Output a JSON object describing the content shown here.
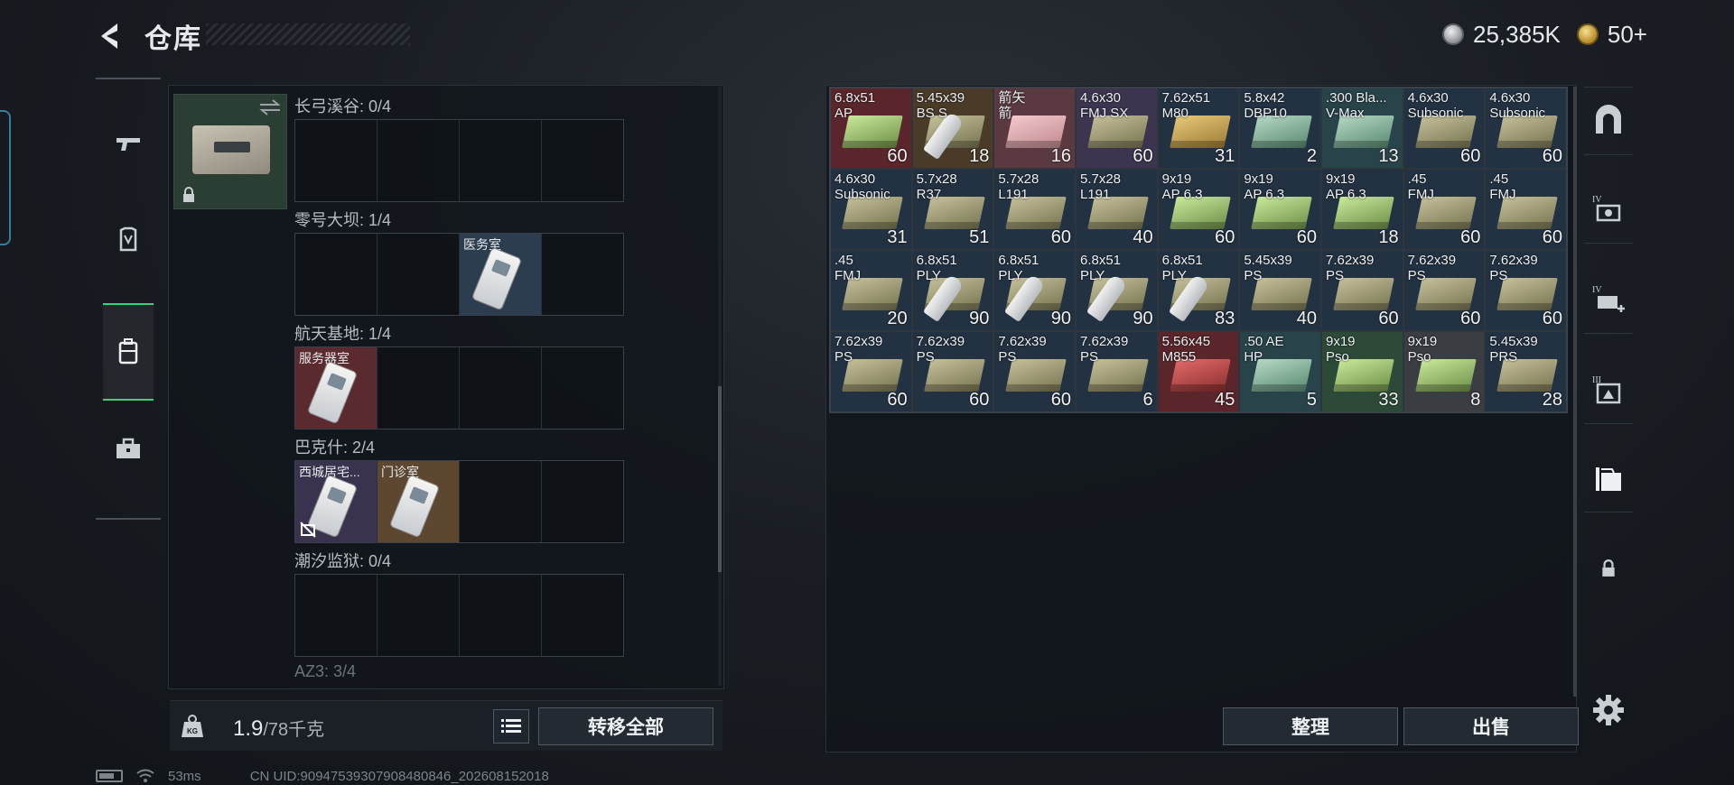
{
  "header": {
    "title": "仓库",
    "currency_silver": "25,385K",
    "currency_gold": "50+",
    "icons": [
      "back-arrow-icon",
      "silver-coin-icon",
      "gold-coin-icon"
    ]
  },
  "left_sidebar": {
    "items": [
      {
        "name": "weapons",
        "icon": "pistol-icon"
      },
      {
        "name": "equipment",
        "icon": "armor-icon"
      },
      {
        "name": "containers",
        "icon": "case-icon",
        "active": true
      },
      {
        "name": "toolkit",
        "icon": "toolbox-icon"
      }
    ]
  },
  "keycase": {
    "maps": [
      {
        "label": "长弓溪谷: 0/4",
        "slots": [
          null,
          null,
          null,
          null
        ]
      },
      {
        "label": "零号大坝: 1/4",
        "slots": [
          null,
          null,
          {
            "name": "医务室",
            "color": "blue"
          },
          null
        ]
      },
      {
        "label": "航天基地: 1/4",
        "slots": [
          {
            "name": "服务器室",
            "color": "red"
          },
          null,
          null,
          null
        ]
      },
      {
        "label": "巴克什: 2/4",
        "slots": [
          {
            "name": "西城居宅...",
            "color": "purple",
            "restricted": true
          },
          {
            "name": "门诊室",
            "color": "orange"
          },
          null,
          null
        ]
      },
      {
        "label": "潮汐监狱: 0/4",
        "slots": [
          null,
          null,
          null,
          null
        ]
      }
    ],
    "next_label": "AZ3: 3/4"
  },
  "weight": {
    "current": "1.9",
    "max": "/78千克"
  },
  "buttons": {
    "transfer_all": "转移全部",
    "tidy": "整理",
    "sell": "出售"
  },
  "grid_items": [
    {
      "name": "6.8x51\nAP",
      "count": "60",
      "bg": "red",
      "box": "greenbox"
    },
    {
      "name": "5.45x39\nBS S",
      "count": "18",
      "bg": "brown",
      "box": "box",
      "shell": true
    },
    {
      "name": "箭矢\n箭",
      "count": "16",
      "bg": "pink",
      "box": "pinkbox"
    },
    {
      "name": "4.6x30\nFMJ SX",
      "count": "60",
      "bg": "purple",
      "box": "box"
    },
    {
      "name": "7.62x51\nM80",
      "count": "31",
      "bg": "blue",
      "box": "yellowbox"
    },
    {
      "name": "5.8x42\nDBP10",
      "count": "2",
      "bg": "blue",
      "box": "tealbox"
    },
    {
      "name": ".300 Bla...\nV-Max",
      "count": "13",
      "bg": "teal",
      "box": "tealbox"
    },
    {
      "name": "4.6x30\nSubsonic",
      "count": "60",
      "bg": "blue",
      "box": "box"
    },
    {
      "name": "4.6x30\nSubsonic",
      "count": "60",
      "bg": "blue",
      "box": "box"
    },
    {
      "name": "4.6x30\nSubsonic",
      "count": "31",
      "bg": "blue",
      "box": "box"
    },
    {
      "name": "5.7x28\nR37",
      "count": "51",
      "bg": "blue",
      "box": "box"
    },
    {
      "name": "5.7x28\nL191",
      "count": "60",
      "bg": "blue",
      "box": "box"
    },
    {
      "name": "5.7x28\nL191",
      "count": "40",
      "bg": "blue",
      "box": "box"
    },
    {
      "name": "9x19\nAP 6.3",
      "count": "60",
      "bg": "blue",
      "box": "greenbox"
    },
    {
      "name": "9x19\nAP 6.3",
      "count": "60",
      "bg": "blue",
      "box": "greenbox"
    },
    {
      "name": "9x19\nAP 6.3",
      "count": "18",
      "bg": "blue",
      "box": "greenbox"
    },
    {
      "name": ".45\nFMJ",
      "count": "60",
      "bg": "blue",
      "box": "box"
    },
    {
      "name": ".45\nFMJ",
      "count": "60",
      "bg": "blue",
      "box": "box"
    },
    {
      "name": ".45\nFMJ",
      "count": "20",
      "bg": "blue",
      "box": "box"
    },
    {
      "name": "6.8x51\nPLY",
      "count": "90",
      "bg": "blue",
      "box": "box",
      "shell": true
    },
    {
      "name": "6.8x51\nPLY",
      "count": "90",
      "bg": "blue",
      "box": "box",
      "shell": true
    },
    {
      "name": "6.8x51\nPLY",
      "count": "90",
      "bg": "blue",
      "box": "box",
      "shell": true
    },
    {
      "name": "6.8x51\nPLY",
      "count": "83",
      "bg": "blue",
      "box": "box",
      "shell": true
    },
    {
      "name": "5.45x39\nPS",
      "count": "40",
      "bg": "blue",
      "box": "box"
    },
    {
      "name": "7.62x39\nPS",
      "count": "60",
      "bg": "blue",
      "box": "box"
    },
    {
      "name": "7.62x39\nPS",
      "count": "60",
      "bg": "blue",
      "box": "box"
    },
    {
      "name": "7.62x39\nPS",
      "count": "60",
      "bg": "blue",
      "box": "box"
    },
    {
      "name": "7.62x39\nPS",
      "count": "60",
      "bg": "blue",
      "box": "box"
    },
    {
      "name": "7.62x39\nPS",
      "count": "60",
      "bg": "blue",
      "box": "box"
    },
    {
      "name": "7.62x39\nPS",
      "count": "60",
      "bg": "blue",
      "box": "box"
    },
    {
      "name": "7.62x39\nPS",
      "count": "6",
      "bg": "blue",
      "box": "box"
    },
    {
      "name": "5.56x45\nM855",
      "count": "45",
      "bg": "red",
      "box": "redbox"
    },
    {
      "name": ".50 AE\nHP",
      "count": "5",
      "bg": "teal",
      "box": "tealbox"
    },
    {
      "name": "9x19\nPso",
      "count": "33",
      "bg": "green",
      "box": "greenbox"
    },
    {
      "name": "9x19\nPso",
      "count": "8",
      "bg": "gray",
      "box": "greenbox"
    },
    {
      "name": "5.45x39\nPRS",
      "count": "28",
      "bg": "blue",
      "box": "box"
    }
  ],
  "right_sidebar": {
    "tabs": [
      {
        "name": "stash-home",
        "icon": "arch-icon"
      },
      {
        "name": "tier-iv-a",
        "icon": "tier-iv-camera-icon",
        "label": "IV"
      },
      {
        "name": "tier-iv-b",
        "icon": "tier-iv-add-icon",
        "label": "IV"
      },
      {
        "name": "tier-iii",
        "icon": "tier-iii-icon",
        "label": "III"
      },
      {
        "name": "sub-stash",
        "icon": "folder-stack-icon"
      },
      {
        "name": "locked",
        "icon": "lock-icon"
      }
    ]
  },
  "status": {
    "ping": "53ms",
    "uid": "CN UID:9094753930790848084​6_202608152018"
  }
}
